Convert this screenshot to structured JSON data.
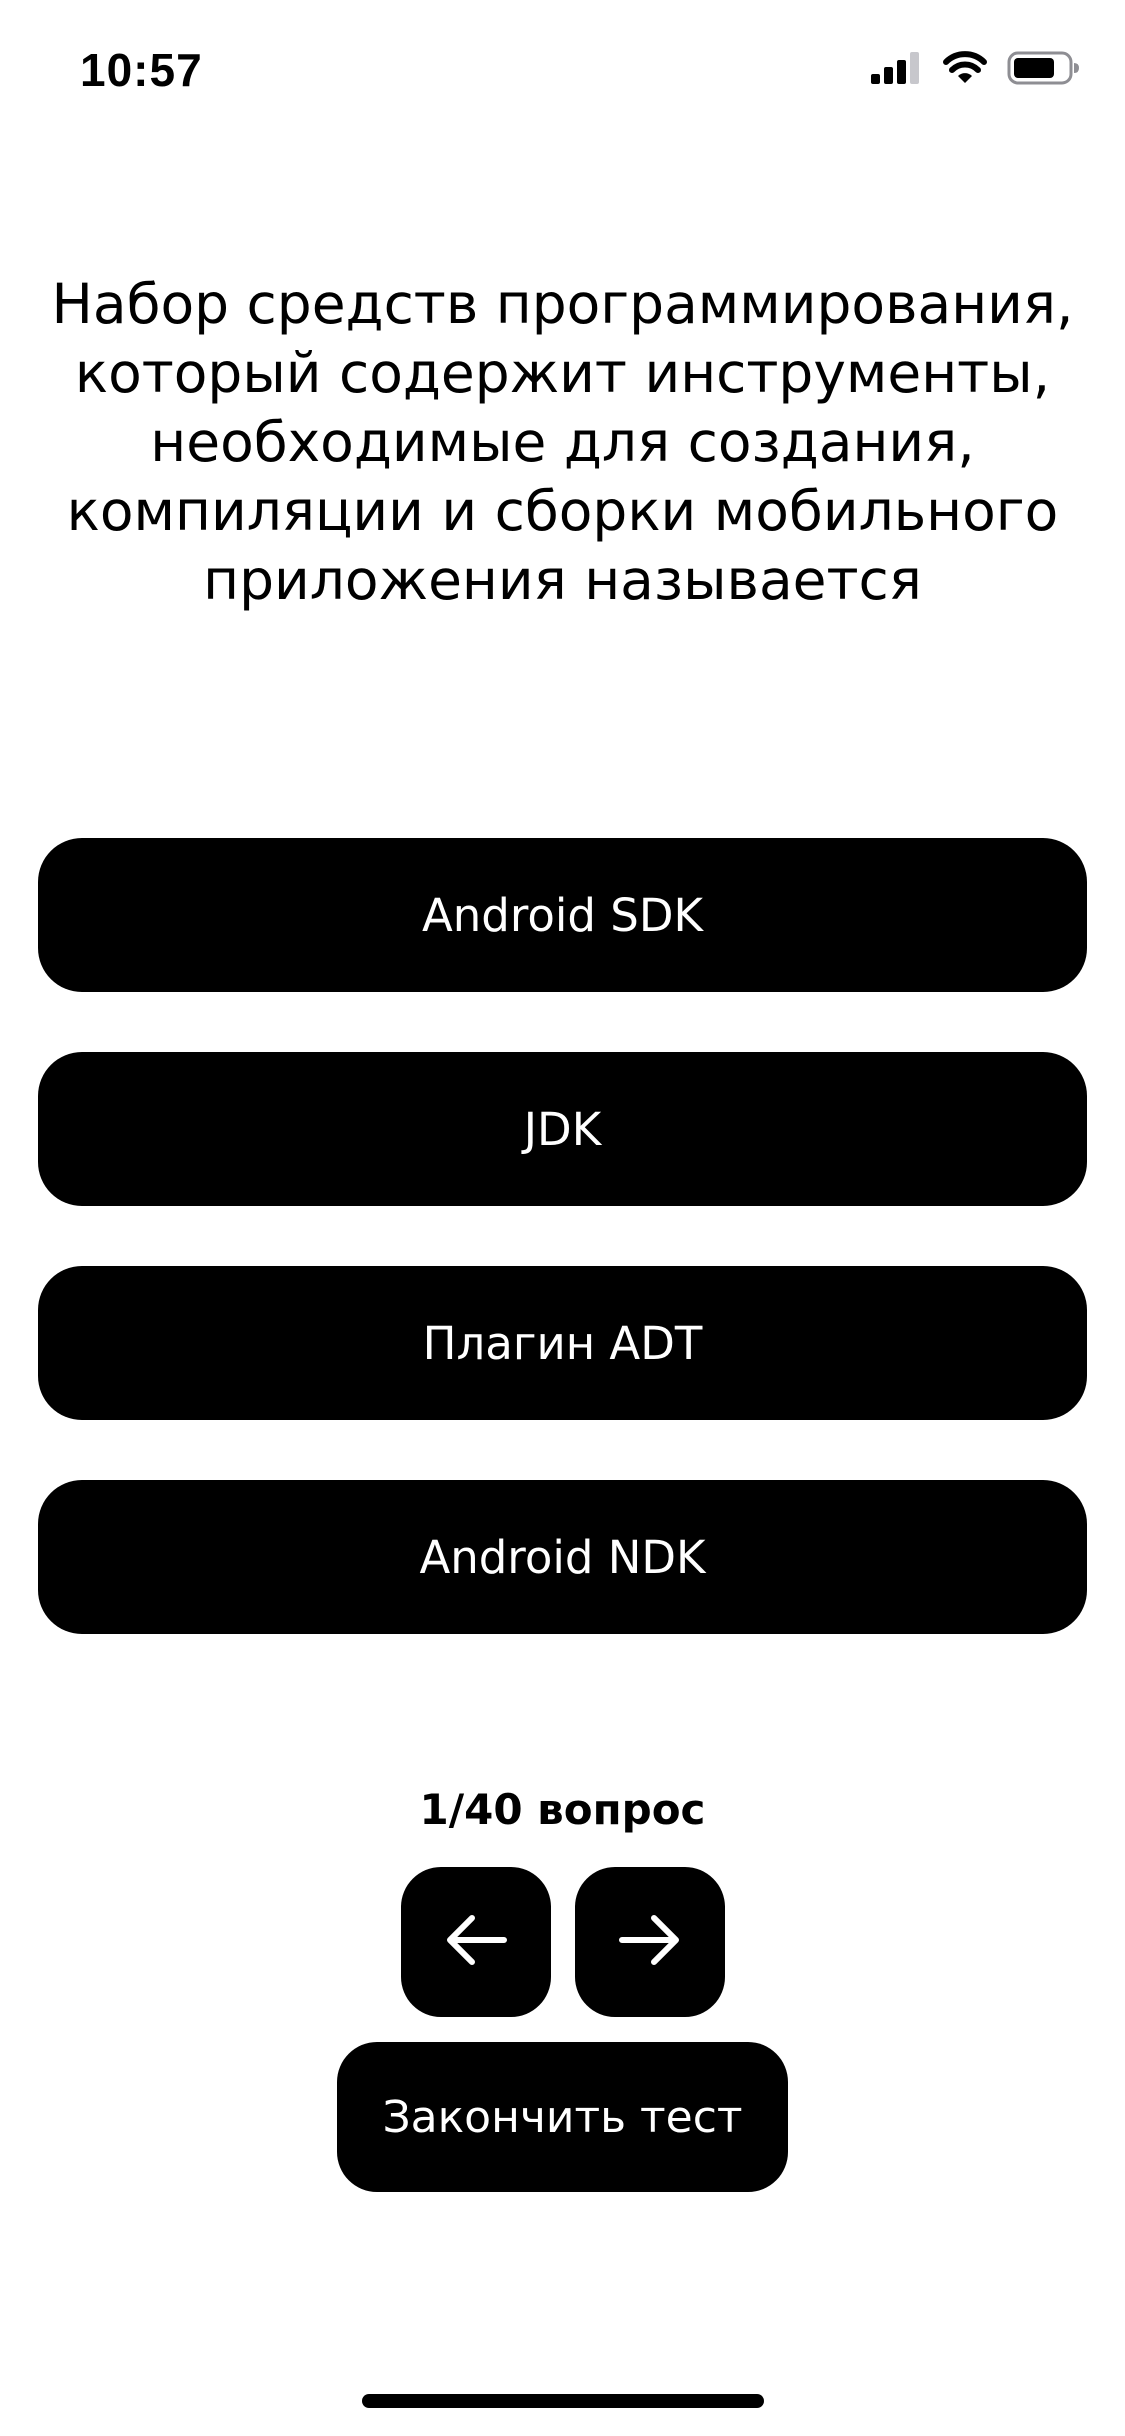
{
  "status_bar": {
    "time": "10:57",
    "icons": [
      "cellular-signal-icon",
      "wifi-icon",
      "battery-icon"
    ]
  },
  "question": {
    "text": "Набор средств программирования, который содержит инструменты, необходимые для создания, компиляции и сборки мобильного приложения называется"
  },
  "answers": [
    {
      "label": "Android SDK"
    },
    {
      "label": "JDK"
    },
    {
      "label": "Плагин ADT"
    },
    {
      "label": "Android NDK"
    }
  ],
  "progress": {
    "label": "1/40 вопрос",
    "current": 1,
    "total": 40
  },
  "navigation": {
    "prev_icon": "arrow-left-icon",
    "next_icon": "arrow-right-icon"
  },
  "finish_label": "Закончить тест",
  "colors": {
    "background": "#ffffff",
    "button": "#000000",
    "button_text": "#ffffff"
  }
}
